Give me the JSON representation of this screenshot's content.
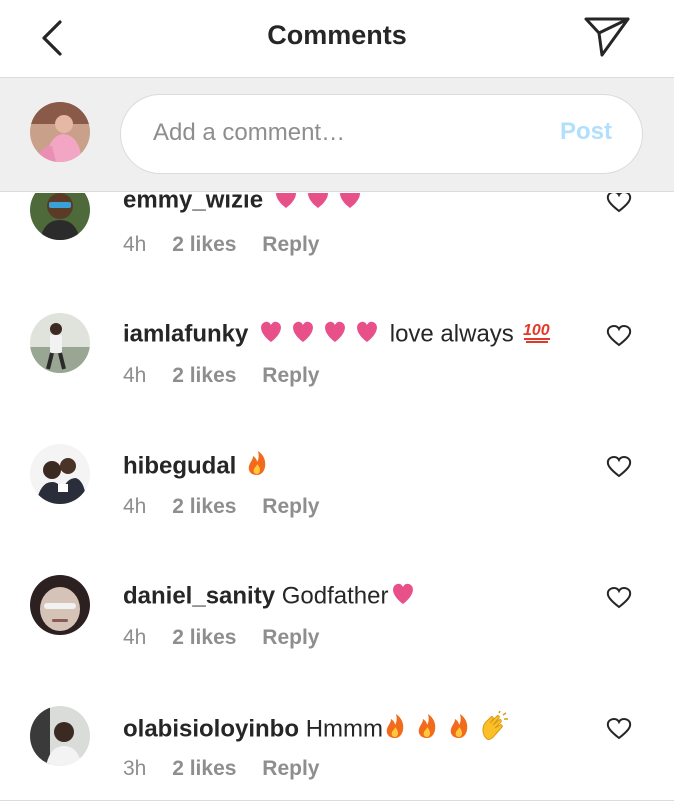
{
  "header": {
    "title": "Comments",
    "back_icon": "chevron-left-icon",
    "send_icon": "paper-plane-icon"
  },
  "composer": {
    "placeholder": "Add a comment…",
    "post_label": "Post",
    "post_color": "#b2dffc"
  },
  "colors": {
    "heart_emoji": "#e8508a",
    "fire_emoji": "#f26b1d",
    "meta_text": "#8e8e8e"
  },
  "comments": [
    {
      "username": "emmy_wizie",
      "text": "",
      "emoji": "❤❤❤",
      "time": "4h",
      "likes": "2 likes",
      "reply": "Reply"
    },
    {
      "username": "iamlafunky",
      "text": "love always",
      "emoji_before": "❤❤❤❤",
      "emoji_after": "💯",
      "time": "4h",
      "likes": "2 likes",
      "reply": "Reply"
    },
    {
      "username": "hibegudal",
      "text": "",
      "emoji": "🔥",
      "time": "4h",
      "likes": "2 likes",
      "reply": "Reply"
    },
    {
      "username": "daniel_sanity",
      "text": "Godfather",
      "emoji": "❤",
      "time": "4h",
      "likes": "2 likes",
      "reply": "Reply"
    },
    {
      "username": "olabisioloyinbo",
      "text": "Hmmm",
      "emoji": "🔥🔥🔥👏",
      "time": "3h",
      "likes": "2 likes",
      "reply": "Reply"
    }
  ]
}
